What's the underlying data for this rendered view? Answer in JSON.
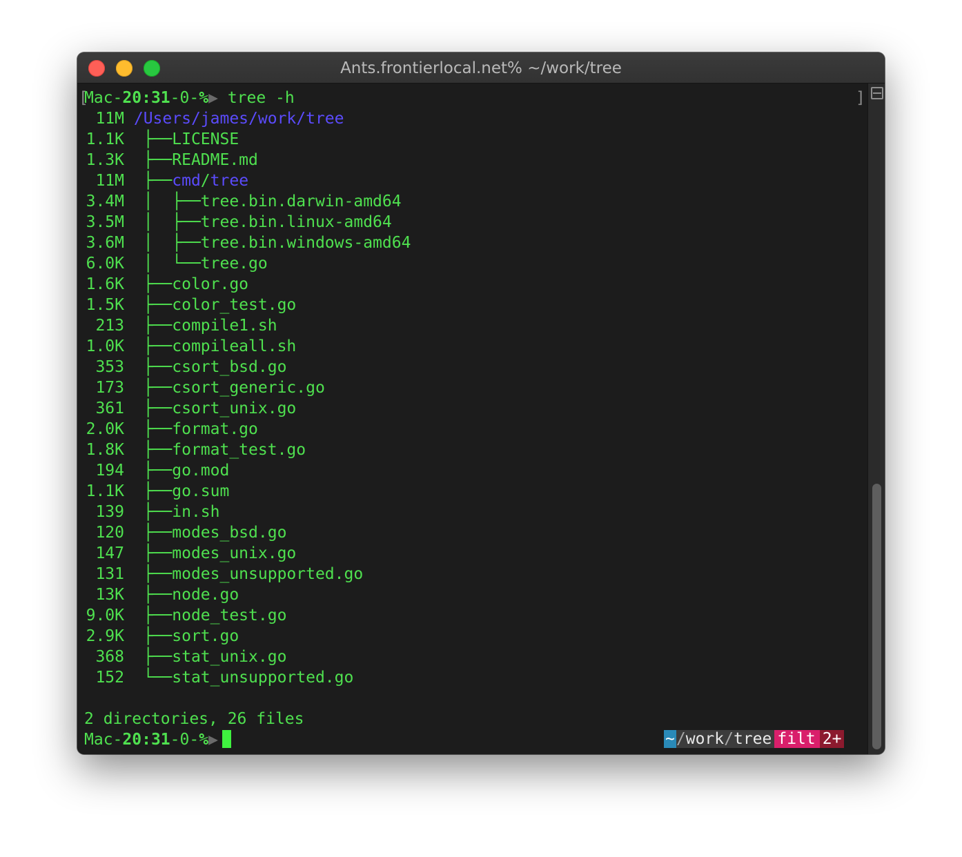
{
  "window": {
    "title": "Ants.frontierlocal.net% ~/work/tree"
  },
  "prompt": {
    "host": "Mac",
    "sep1": "-",
    "time": "20:31",
    "sep2": "-",
    "status": "0",
    "sep3": "-",
    "symbol": "%",
    "arrow": "▶",
    "command": "tree -h"
  },
  "brackets": {
    "left": "[",
    "right": "]"
  },
  "tree": {
    "root": {
      "size": "11M",
      "path": "/Users/james/work/tree"
    },
    "entries": [
      {
        "size": "1.1K",
        "prefix": "├──",
        "name": "LICENSE"
      },
      {
        "size": "1.3K",
        "prefix": "├──",
        "name": "README.md"
      },
      {
        "size": "11M",
        "prefix": "├──",
        "dir_a": "cmd",
        "dir_sep": "/",
        "dir_b": "tree"
      },
      {
        "size": "3.4M",
        "prefix": "│  ├──",
        "name": "tree.bin.darwin-amd64"
      },
      {
        "size": "3.5M",
        "prefix": "│  ├──",
        "name": "tree.bin.linux-amd64"
      },
      {
        "size": "3.6M",
        "prefix": "│  ├──",
        "name": "tree.bin.windows-amd64"
      },
      {
        "size": "6.0K",
        "prefix": "│  └──",
        "name": "tree.go"
      },
      {
        "size": "1.6K",
        "prefix": "├──",
        "name": "color.go"
      },
      {
        "size": "1.5K",
        "prefix": "├──",
        "name": "color_test.go"
      },
      {
        "size": "213",
        "prefix": "├──",
        "name": "compile1.sh"
      },
      {
        "size": "1.0K",
        "prefix": "├──",
        "name": "compileall.sh"
      },
      {
        "size": "353",
        "prefix": "├──",
        "name": "csort_bsd.go"
      },
      {
        "size": "173",
        "prefix": "├──",
        "name": "csort_generic.go"
      },
      {
        "size": "361",
        "prefix": "├──",
        "name": "csort_unix.go"
      },
      {
        "size": "2.0K",
        "prefix": "├──",
        "name": "format.go"
      },
      {
        "size": "1.8K",
        "prefix": "├──",
        "name": "format_test.go"
      },
      {
        "size": "194",
        "prefix": "├──",
        "name": "go.mod"
      },
      {
        "size": "1.1K",
        "prefix": "├──",
        "name": "go.sum"
      },
      {
        "size": "139",
        "prefix": "├──",
        "name": "in.sh"
      },
      {
        "size": "120",
        "prefix": "├──",
        "name": "modes_bsd.go"
      },
      {
        "size": "147",
        "prefix": "├──",
        "name": "modes_unix.go"
      },
      {
        "size": "131",
        "prefix": "├──",
        "name": "modes_unsupported.go"
      },
      {
        "size": "13K",
        "prefix": "├──",
        "name": "node.go"
      },
      {
        "size": "9.0K",
        "prefix": "├──",
        "name": "node_test.go"
      },
      {
        "size": "2.9K",
        "prefix": "├──",
        "name": "sort.go"
      },
      {
        "size": "368",
        "prefix": "├──",
        "name": "stat_unix.go"
      },
      {
        "size": "152",
        "prefix": "└──",
        "name": "stat_unsupported.go"
      }
    ],
    "summary": "2 directories, 26 files"
  },
  "statusbar": {
    "tilde": "~",
    "slash1": "/",
    "dir1": "work",
    "slash2": "/",
    "dir2": "tree",
    "branch": "filt",
    "count": "2+"
  },
  "colors": {
    "terminal_bg": "#1c1c1c",
    "text_green": "#4fe04f",
    "directory_blue": "#5b4bfc",
    "cursor": "#3ff23f",
    "status_tilde": "#2a8ab8",
    "status_branch": "#d91f6b",
    "status_count": "#8c1a2e"
  },
  "icons": [
    "close-button-icon",
    "minimize-button-icon",
    "zoom-button-icon",
    "split-pane-icon"
  ]
}
